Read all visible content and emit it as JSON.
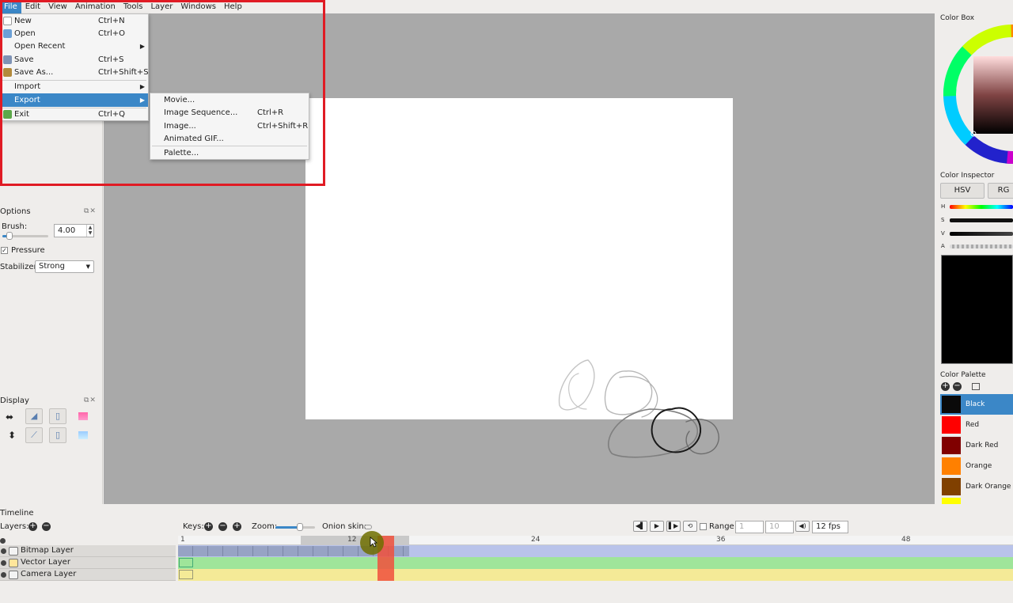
{
  "menubar": [
    "File",
    "Edit",
    "View",
    "Animation",
    "Tools",
    "Layer",
    "Windows",
    "Help"
  ],
  "file_menu": [
    {
      "label": "New",
      "shortcut": "Ctrl+N",
      "icon": "new-file-icon"
    },
    {
      "label": "Open",
      "shortcut": "Ctrl+O",
      "icon": "open-folder-icon"
    },
    {
      "label": "Open Recent",
      "shortcut": "",
      "icon": "",
      "submenu": true
    },
    {
      "label": "Save",
      "shortcut": "Ctrl+S",
      "icon": "save-icon"
    },
    {
      "label": "Save As...",
      "shortcut": "Ctrl+Shift+S",
      "icon": "save-as-icon"
    },
    {
      "label": "Import",
      "shortcut": "",
      "icon": "",
      "submenu": true
    },
    {
      "label": "Export",
      "shortcut": "",
      "icon": "",
      "submenu": true,
      "highlighted": true
    },
    {
      "label": "Exit",
      "shortcut": "Ctrl+Q",
      "icon": "exit-icon"
    }
  ],
  "export_menu": [
    {
      "label": "Movie...",
      "shortcut": ""
    },
    {
      "label": "Image Sequence...",
      "shortcut": "Ctrl+R"
    },
    {
      "label": "Image...",
      "shortcut": "Ctrl+Shift+R"
    },
    {
      "label": "Animated GIF...",
      "shortcut": ""
    },
    {
      "label": "Palette...",
      "shortcut": ""
    }
  ],
  "options": {
    "title": "Options",
    "brush_label": "Brush:",
    "brush_value": "4.00",
    "pressure_label": "Pressure",
    "pressure_checked": "✓",
    "stabilizer_label": "Stabilizer",
    "stabilizer_value": "Strong"
  },
  "display": {
    "title": "Display"
  },
  "color_box": {
    "title": "Color Box"
  },
  "color_inspector": {
    "title": "Color Inspector",
    "tabs": [
      "HSV",
      "RG"
    ],
    "channels": [
      "H",
      "S",
      "V",
      "A"
    ],
    "current_color": "#000000"
  },
  "color_palette": {
    "title": "Color Palette",
    "colors": [
      {
        "name": "Black",
        "hex": "#0a0a0a",
        "selected": true
      },
      {
        "name": "Red",
        "hex": "#ff0000"
      },
      {
        "name": "Dark Red",
        "hex": "#800000"
      },
      {
        "name": "Orange",
        "hex": "#ff8000"
      },
      {
        "name": "Dark Orange",
        "hex": "#804000"
      }
    ]
  },
  "timeline": {
    "title": "Timeline",
    "layers_label": "Layers:",
    "keys_label": "Keys:",
    "zoom_label": "Zoom:",
    "onion_label": "Onion skin:",
    "range_label": "Range",
    "range_start": "1",
    "range_end": "10",
    "fps": "12 fps",
    "ruler_ticks": [
      "1",
      "12",
      "24",
      "36",
      "48"
    ],
    "current_frame": 12,
    "layers": [
      "Bitmap Layer",
      "Vector Layer",
      "Camera Layer"
    ]
  },
  "colors": {
    "accent": "#3b87c7",
    "canvas_bg": "#a9a9a9",
    "highlight_box": "#e01b24"
  }
}
